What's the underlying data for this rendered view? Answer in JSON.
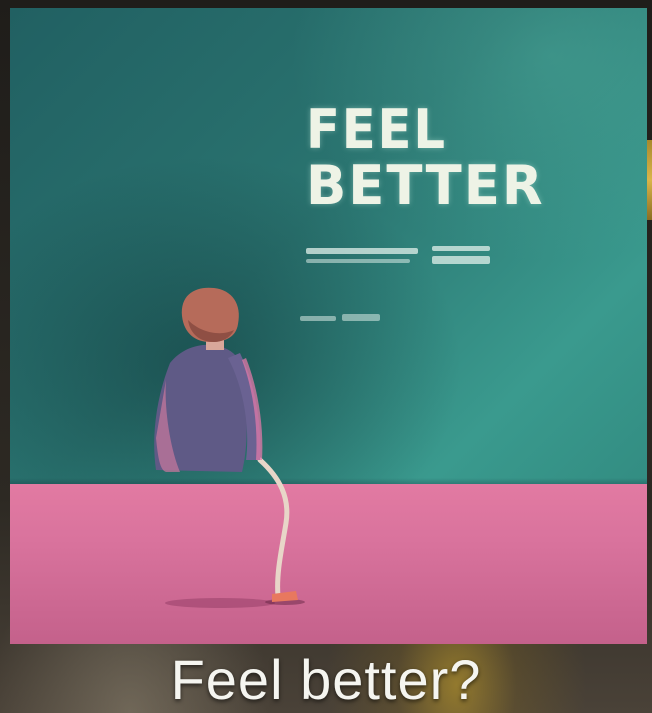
{
  "artwork": {
    "poster_line1": "FEEL",
    "poster_line2": "BETTER"
  },
  "caption": {
    "text": "Feel better?"
  },
  "colors": {
    "wall": "#2a7470",
    "floor": "#d9739d",
    "caption_text": "#f5f5f0"
  }
}
